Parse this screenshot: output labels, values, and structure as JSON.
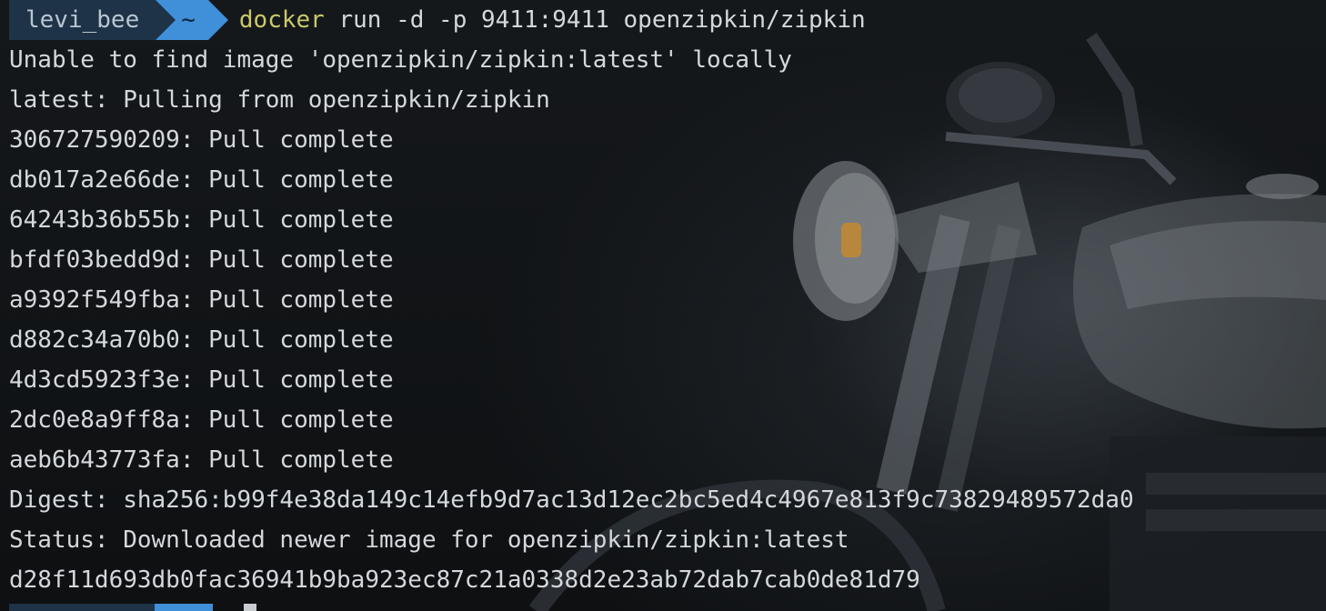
{
  "prompt": {
    "user": "levi_bee",
    "directory": "~",
    "command_name": "docker",
    "command_args": " run -d -p 9411:9411 openzipkin/zipkin"
  },
  "output": [
    "Unable to find image 'openzipkin/zipkin:latest' locally",
    "latest: Pulling from openzipkin/zipkin",
    "306727590209: Pull complete",
    "db017a2e66de: Pull complete",
    "64243b36b55b: Pull complete",
    "bfdf03bedd9d: Pull complete",
    "a9392f549fba: Pull complete",
    "d882c34a70b0: Pull complete",
    "4d3cd5923f3e: Pull complete",
    "2dc0e8a9ff8a: Pull complete",
    "aeb6b43773fa: Pull complete",
    "Digest: sha256:b99f4e38da149c14efb9d7ac13d12ec2bc5ed4c4967e813f9c73829489572da0",
    "Status: Downloaded newer image for openzipkin/zipkin:latest",
    "d28f11d693db0fac36941b9ba923ec87c21a0338d2e23ab72dab7cab0de81d79"
  ],
  "colors": {
    "user_segment": "#1e3347",
    "dir_segment": "#3f8fd9",
    "command_name": "#c9c96a",
    "text": "#d4d8dc"
  },
  "wallpaper": "motorcycle-background"
}
